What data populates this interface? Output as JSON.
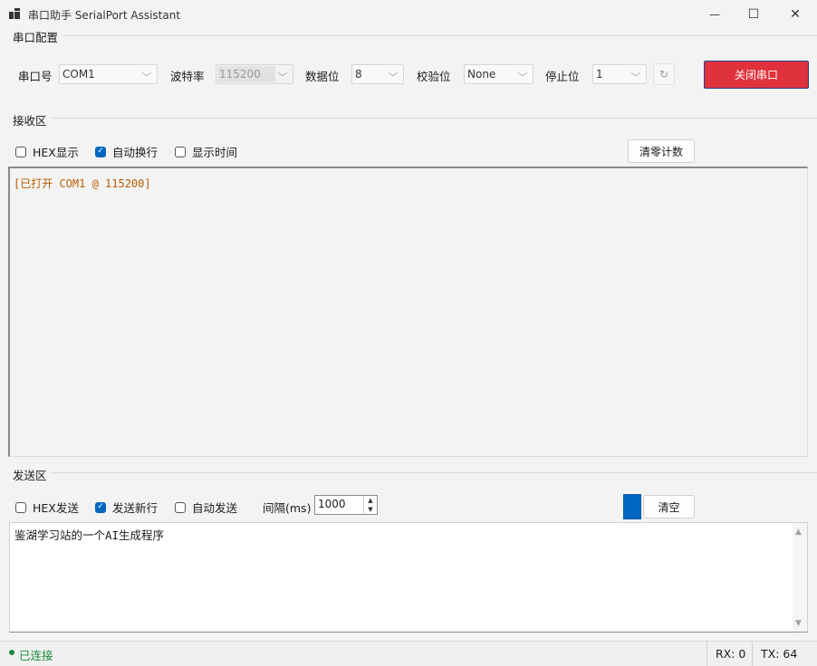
{
  "window": {
    "title": "串口助手 SerialPort Assistant",
    "minimize_glyph": "—",
    "maximize_glyph": "☐",
    "close_glyph": "✕"
  },
  "config": {
    "group_label": "串口配置",
    "port": {
      "label": "串口号",
      "value": "COM1"
    },
    "baud": {
      "label": "波特率",
      "value": "115200"
    },
    "databits": {
      "label": "数据位",
      "value": "8"
    },
    "parity": {
      "label": "校验位",
      "value": "None"
    },
    "stopbits": {
      "label": "停止位",
      "value": "1"
    },
    "refresh_glyph": "↻",
    "close_port_label": "关闭串口"
  },
  "receive": {
    "group_label": "接收区",
    "hex_display": {
      "label": "HEX显示",
      "checked": false
    },
    "auto_wrap": {
      "label": "自动换行",
      "checked": true
    },
    "show_time": {
      "label": "显示时间",
      "checked": false
    },
    "clear_count_label": "清零计数",
    "text": "[已打开 COM1 @ 115200]"
  },
  "send": {
    "group_label": "发送区",
    "hex_send": {
      "label": "HEX发送",
      "checked": false
    },
    "newline": {
      "label": "发送新行",
      "checked": true
    },
    "auto_send": {
      "label": "自动发送",
      "checked": false
    },
    "interval_label": "间隔(ms)",
    "interval_value": "1000",
    "clear_label": "清空",
    "text": "鉴湖学习站的一个AI生成程序"
  },
  "status": {
    "connection": "已连接",
    "rx": "RX: 0",
    "tx": "TX: 64"
  },
  "colors": {
    "accent": "#0067c0",
    "close_button": "#e0323c",
    "connected": "#1a8a3a",
    "receive_text": "#b85c00"
  }
}
